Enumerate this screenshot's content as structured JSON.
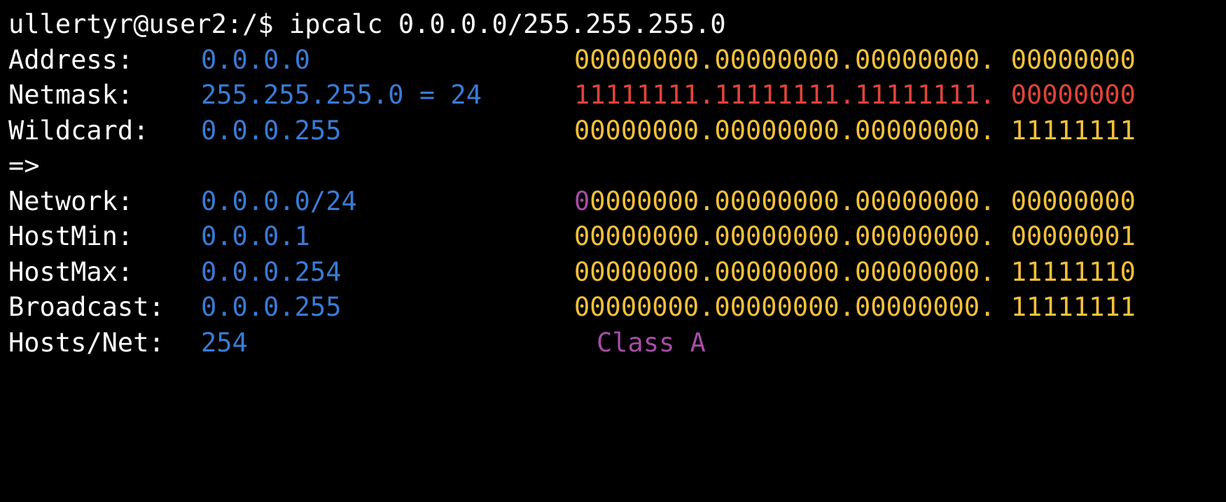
{
  "colors": {
    "background": "#000000",
    "text": "#ffffff",
    "value": "#3a7bd5",
    "binary": "#f3c13a",
    "netmask_binary": "#e0443a",
    "network_bit": "#a64ca6",
    "class": "#a64ca6"
  },
  "terminal": {
    "prompt": "ullertyr@user2:/$ ",
    "command": "ipcalc 0.0.0.0/255.255.255.0",
    "rows_before": [
      {
        "label": "Address:",
        "value": "0.0.0.0",
        "binary": "00000000.00000000.00000000. 00000000",
        "style": "plain"
      },
      {
        "label": "Netmask:",
        "value": "255.255.255.0 = 24",
        "binary": "11111111.11111111.11111111. 00000000",
        "style": "netmask"
      },
      {
        "label": "Wildcard:",
        "value": "0.0.0.255",
        "binary": "00000000.00000000.00000000. 11111111",
        "style": "plain"
      }
    ],
    "arrow": "=>",
    "network": {
      "label": "Network:",
      "value": "0.0.0.0/24",
      "binary_first": "0",
      "binary_rest": "0000000.00000000.00000000. 00000000"
    },
    "rows_after": [
      {
        "label": "HostMin:",
        "value": "0.0.0.1",
        "binary": "00000000.00000000.00000000. 00000001"
      },
      {
        "label": "HostMax:",
        "value": "0.0.0.254",
        "binary": "00000000.00000000.00000000. 11111110"
      },
      {
        "label": "Broadcast:",
        "value": "0.0.0.255",
        "binary": "00000000.00000000.00000000. 11111111"
      }
    ],
    "hosts": {
      "label": "Hosts/Net:",
      "value": "254",
      "class": "Class A"
    }
  }
}
